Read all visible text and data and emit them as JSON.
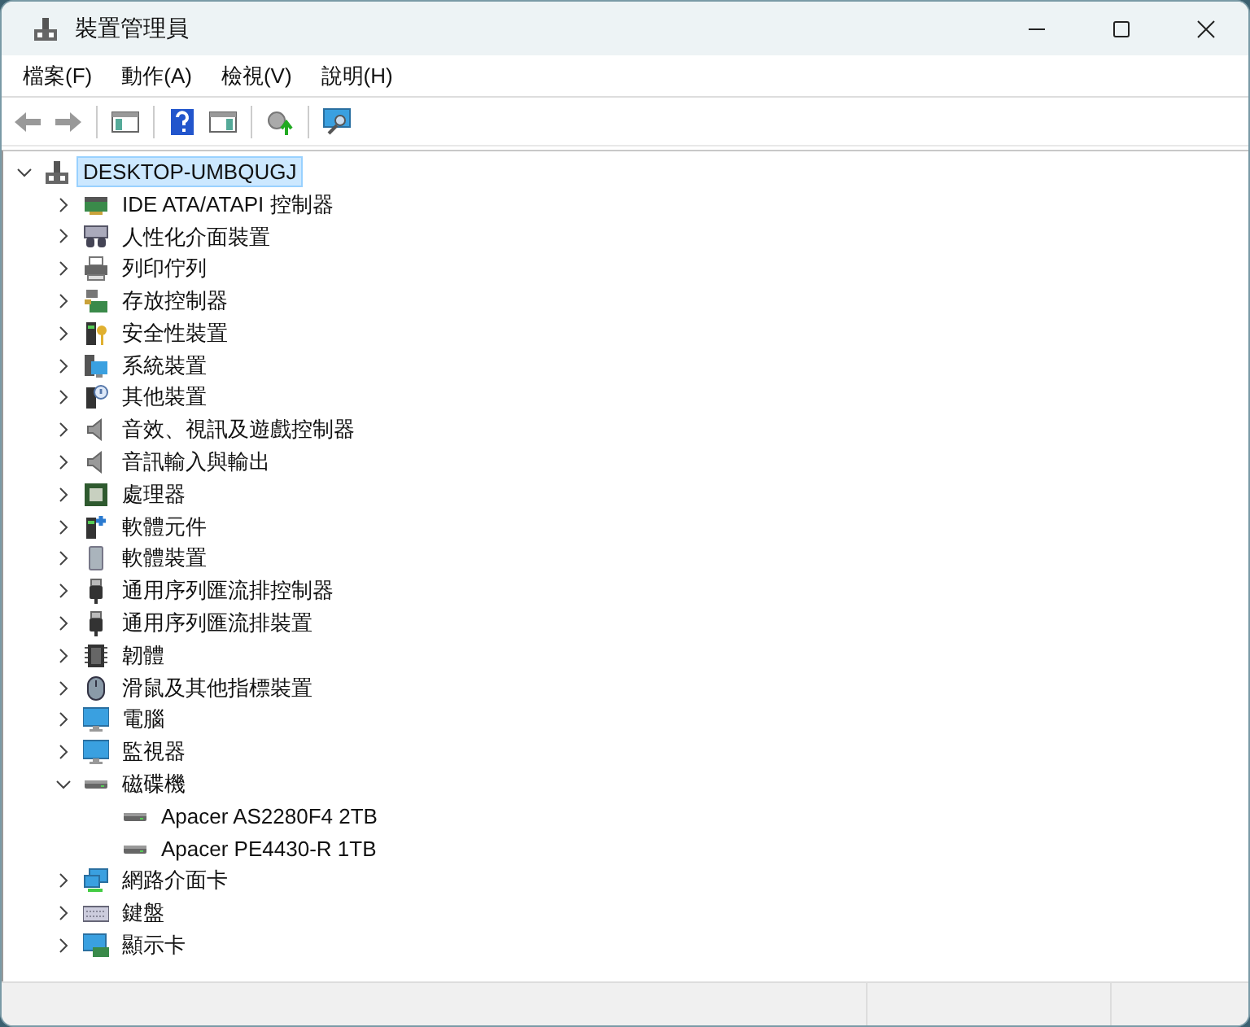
{
  "window": {
    "title": "裝置管理員"
  },
  "menu": [
    "檔案(F)",
    "動作(A)",
    "檢視(V)",
    "說明(H)"
  ],
  "toolbar": [
    {
      "kind": "back",
      "disabled": true
    },
    {
      "kind": "forward",
      "disabled": true
    },
    {
      "kind": "separator"
    },
    {
      "kind": "console-tree"
    },
    {
      "kind": "separator"
    },
    {
      "kind": "help"
    },
    {
      "kind": "action-pane"
    },
    {
      "kind": "separator"
    },
    {
      "kind": "update-driver"
    },
    {
      "kind": "separator"
    },
    {
      "kind": "scan"
    }
  ],
  "tree": {
    "label": "DESKTOP-UMBQUGJ",
    "kind": "computer",
    "expanded": true,
    "selected": true,
    "children": [
      {
        "label": "IDE ATA/ATAPI 控制器",
        "kind": "card",
        "expanded": false
      },
      {
        "label": "人性化介面裝置",
        "kind": "hid",
        "expanded": false
      },
      {
        "label": "列印佇列",
        "kind": "printer",
        "expanded": false
      },
      {
        "label": "存放控制器",
        "kind": "storage",
        "expanded": false
      },
      {
        "label": "安全性裝置",
        "kind": "security",
        "expanded": false
      },
      {
        "label": "系統裝置",
        "kind": "system",
        "expanded": false
      },
      {
        "label": "其他裝置",
        "kind": "other",
        "expanded": false
      },
      {
        "label": "音效、視訊及遊戲控制器",
        "kind": "speaker",
        "expanded": false
      },
      {
        "label": "音訊輸入與輸出",
        "kind": "speaker",
        "expanded": false
      },
      {
        "label": "處理器",
        "kind": "cpu",
        "expanded": false
      },
      {
        "label": "軟體元件",
        "kind": "software",
        "expanded": false
      },
      {
        "label": "軟體裝置",
        "kind": "softdev",
        "expanded": false
      },
      {
        "label": "通用序列匯流排控制器",
        "kind": "usb",
        "expanded": false
      },
      {
        "label": "通用序列匯流排裝置",
        "kind": "usb",
        "expanded": false
      },
      {
        "label": "韌體",
        "kind": "chip",
        "expanded": false
      },
      {
        "label": "滑鼠及其他指標裝置",
        "kind": "mouse",
        "expanded": false
      },
      {
        "label": "電腦",
        "kind": "monitor",
        "expanded": false
      },
      {
        "label": "監視器",
        "kind": "monitor",
        "expanded": false
      },
      {
        "label": "磁碟機",
        "kind": "disk",
        "expanded": true,
        "children": [
          {
            "label": "Apacer AS2280F4 2TB",
            "kind": "disk"
          },
          {
            "label": "Apacer PE4430-R 1TB",
            "kind": "disk"
          }
        ]
      },
      {
        "label": "網路介面卡",
        "kind": "network",
        "expanded": false
      },
      {
        "label": "鍵盤",
        "kind": "keyboard",
        "expanded": false
      },
      {
        "label": "顯示卡",
        "kind": "display",
        "expanded": false
      }
    ]
  }
}
